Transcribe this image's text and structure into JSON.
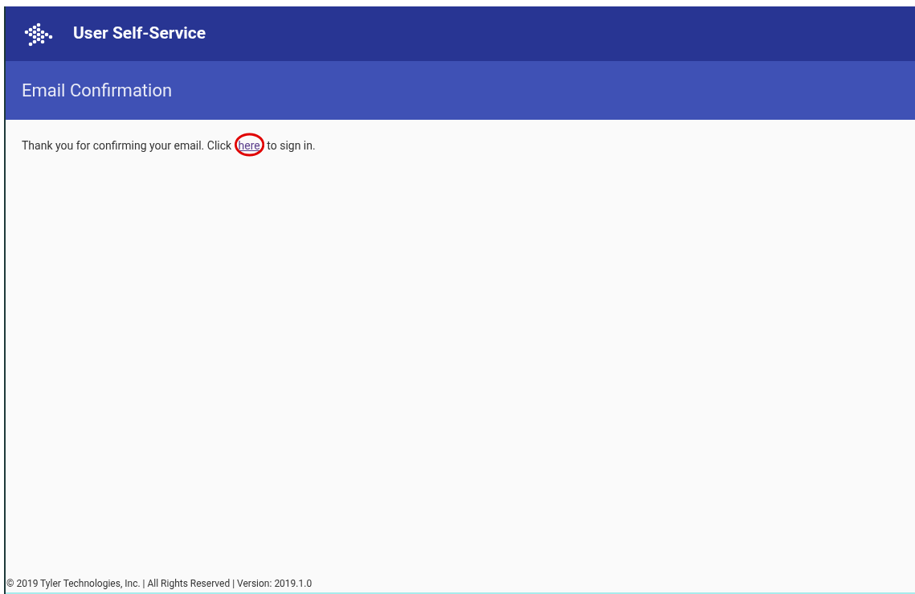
{
  "header": {
    "title": "User Self-Service"
  },
  "page_title": "Email Confirmation",
  "message": {
    "before": "Thank you for confirming your email. Click ",
    "link": "here",
    "after": " to sign in.",
    "link_circled": true
  },
  "footer": "© 2019 Tyler Technologies, Inc. | All Rights Reserved | Version: 2019.1.0"
}
